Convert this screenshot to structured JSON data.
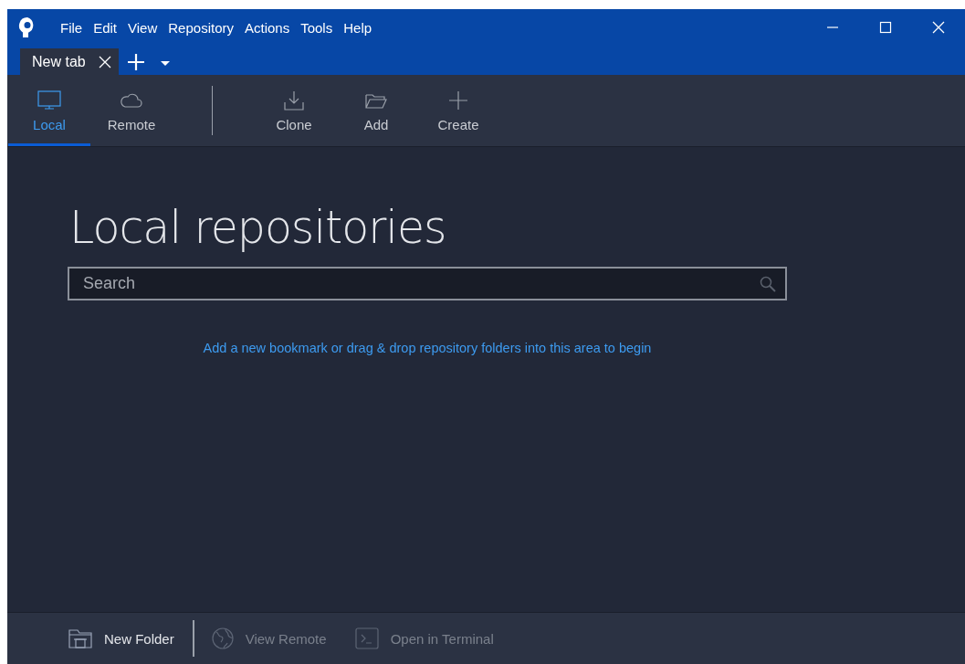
{
  "menu": [
    "File",
    "Edit",
    "View",
    "Repository",
    "Actions",
    "Tools",
    "Help"
  ],
  "tabs": [
    {
      "label": "New tab",
      "selected": true
    }
  ],
  "toolbar": {
    "modes": [
      {
        "label": "Local",
        "kind": "local",
        "selected": true
      },
      {
        "label": "Remote",
        "kind": "remote",
        "selected": false
      }
    ],
    "actions": [
      {
        "label": "Clone",
        "kind": "clone"
      },
      {
        "label": "Add",
        "kind": "add"
      },
      {
        "label": "Create",
        "kind": "create"
      }
    ]
  },
  "main": {
    "heading": "Local repositories",
    "search": {
      "placeholder": "Search"
    },
    "hint": "Add a new bookmark or drag & drop repository folders into this area to begin"
  },
  "footer": [
    {
      "label": "New Folder",
      "kind": "new-folder",
      "disabled": false
    },
    {
      "label": "View Remote",
      "kind": "view-remote",
      "disabled": true
    },
    {
      "label": "Open in Terminal",
      "kind": "terminal",
      "disabled": true
    }
  ]
}
